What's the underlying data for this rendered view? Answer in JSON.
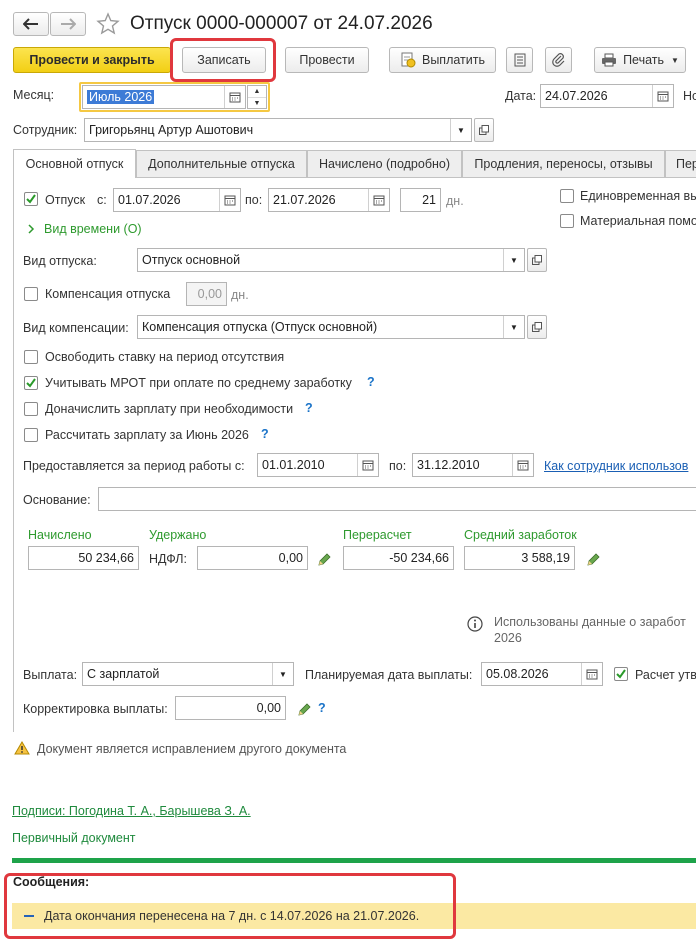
{
  "window": {
    "title": "Отпуск 0000-000007 от 24.07.2026"
  },
  "toolbar": {
    "post_close": "Провести и закрыть",
    "save": "Записать",
    "post": "Провести",
    "pay": "Выплатить",
    "print": "Печать"
  },
  "header": {
    "month_label": "Месяц:",
    "month_value": "Июль 2026",
    "date_label": "Дата:",
    "date_value": "24.07.2026",
    "number_label_cut": "Но",
    "employee_label": "Сотрудник:",
    "employee_value": "Григорьянц Артур Ашотович"
  },
  "tabs": [
    {
      "label": "Основной отпуск",
      "active": true
    },
    {
      "label": "Дополнительные отпуска"
    },
    {
      "label": "Начислено (подробно)"
    },
    {
      "label": "Продления, переносы, отзывы"
    },
    {
      "label": "Пер"
    }
  ],
  "vacation": {
    "checkbox_label": "Отпуск",
    "from_label": "с:",
    "from_value": "01.07.2026",
    "to_label": "по:",
    "to_value": "21.07.2026",
    "days_value": "21",
    "days_unit": "дн.",
    "time_kind_link": "Вид времени (О)",
    "one_time_label": "Единовременная вы",
    "material_help_label": "Материальная помо",
    "kind_label": "Вид отпуска:",
    "kind_value": "Отпуск основной",
    "compensation_label": "Компенсация отпуска",
    "compensation_days": "0,00",
    "compensation_unit": "дн.",
    "comp_kind_label": "Вид компенсации:",
    "comp_kind_value": "Компенсация отпуска (Отпуск основной)"
  },
  "options": [
    {
      "label": "Освободить ставку на период отсутствия",
      "checked": false,
      "help": false
    },
    {
      "label": "Учитывать МРОТ при оплате по среднему заработку",
      "checked": true,
      "help": true
    },
    {
      "label": "Доначислить зарплату при необходимости",
      "checked": false,
      "help": true
    },
    {
      "label": "Рассчитать зарплату за Июнь 2026",
      "checked": false,
      "help": true
    }
  ],
  "period": {
    "label": "Предоставляется за период работы с:",
    "from_value": "01.01.2010",
    "to_label": "по:",
    "to_value": "31.12.2010",
    "link": "Как сотрудник использов"
  },
  "basis": {
    "label": "Основание:",
    "value": ""
  },
  "totals": {
    "accrued_label": "Начислено",
    "accrued_value": "50 234,66",
    "withheld_label": "Удержано",
    "ndfl_label": "НДФЛ:",
    "ndfl_value": "0,00",
    "recalc_label": "Перерасчет",
    "recalc_value": "-50 234,66",
    "avg_label": "Средний заработок",
    "avg_value": "3 588,19"
  },
  "info": {
    "line1": "Использованы данные о заработ",
    "line2": "2026"
  },
  "payment": {
    "label": "Выплата:",
    "value": "С зарплатой",
    "planned_label": "Планируемая дата выплаты:",
    "planned_value": "05.08.2026",
    "calc_label": "Расчет утв",
    "correction_label": "Корректировка выплаты:",
    "correction_value": "0,00"
  },
  "warning": "Документ является исправлением другого документа",
  "footer": {
    "signatures_link": "Подписи: Погодина Т. А., Барышева З. А.",
    "primary_doc_link": "Первичный документ"
  },
  "messages": {
    "title": "Сообщения:",
    "item": "Дата окончания перенесена на 7 дн. с 14.07.2026 на 21.07.2026."
  },
  "colors": {
    "accent_yellow": "#f5d21c",
    "highlight_red": "#e0383e",
    "green_bar": "#1ea34a",
    "message_bg": "#fbe9a3"
  }
}
